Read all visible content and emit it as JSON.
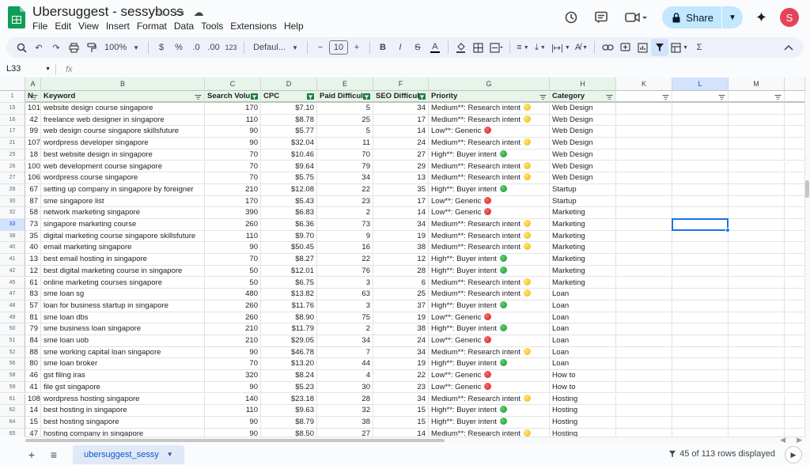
{
  "app": {
    "title": "Ubersuggest - sessyboss",
    "menus": [
      "File",
      "Edit",
      "View",
      "Insert",
      "Format",
      "Data",
      "Tools",
      "Extensions",
      "Help"
    ],
    "share_label": "Share",
    "avatar_letter": "S",
    "brand_color": "#0f9d58"
  },
  "toolbar": {
    "zoom": "100%",
    "currency": "$",
    "percent": "%",
    "dec_decrease": ".0",
    "dec_increase": ".00",
    "number_format": "123",
    "font": "Defaul...",
    "font_size": "10",
    "minus": "−",
    "plus": "+",
    "bold": "B",
    "italic": "I",
    "strike": "S",
    "text_color": "A"
  },
  "formula_bar": {
    "cell_ref": "L33",
    "fx": "fx"
  },
  "columns": {
    "letters": [
      "A",
      "B",
      "C",
      "D",
      "E",
      "F",
      "G",
      "H",
      "K",
      "L",
      "M"
    ],
    "headers": [
      "N",
      "Keyword",
      "Search Volu",
      "CPC",
      "Paid Difficul",
      "SEO Difficul",
      "Priority",
      "Category",
      "",
      "",
      ""
    ]
  },
  "rows": [
    {
      "row": "15",
      "n": "101",
      "keyword": "website design course singapore",
      "vol": "170",
      "cpc": "$7.10",
      "paid": "5",
      "seo": "34",
      "priority": "Medium**: Research intent",
      "dot": "yellow",
      "cat": "Web Design"
    },
    {
      "row": "16",
      "n": "42",
      "keyword": "freelance web designer in singapore",
      "vol": "110",
      "cpc": "$8.78",
      "paid": "25",
      "seo": "17",
      "priority": "Medium**: Research intent",
      "dot": "yellow",
      "cat": "Web Design"
    },
    {
      "row": "17",
      "n": "99",
      "keyword": "web design course singapore skillsfuture",
      "vol": "90",
      "cpc": "$5.77",
      "paid": "5",
      "seo": "14",
      "priority": "Low**: Generic",
      "dot": "red",
      "cat": "Web Design"
    },
    {
      "row": "21",
      "n": "107",
      "keyword": "wordpress developer singapore",
      "vol": "90",
      "cpc": "$32.04",
      "paid": "11",
      "seo": "24",
      "priority": "Medium**: Research intent",
      "dot": "yellow",
      "cat": "Web Design"
    },
    {
      "row": "25",
      "n": "18",
      "keyword": "best website design in singapore",
      "vol": "70",
      "cpc": "$10.46",
      "paid": "70",
      "seo": "27",
      "priority": "High**: Buyer intent",
      "dot": "green",
      "cat": "Web Design"
    },
    {
      "row": "26",
      "n": "100",
      "keyword": "web development course singapore",
      "vol": "70",
      "cpc": "$9.64",
      "paid": "79",
      "seo": "29",
      "priority": "Medium**: Research intent",
      "dot": "yellow",
      "cat": "Web Design"
    },
    {
      "row": "27",
      "n": "106",
      "keyword": "wordpress course singapore",
      "vol": "70",
      "cpc": "$5.75",
      "paid": "34",
      "seo": "13",
      "priority": "Medium**: Research intent",
      "dot": "yellow",
      "cat": "Web Design"
    },
    {
      "row": "28",
      "n": "67",
      "keyword": "setting up company in singapore by foreigner",
      "vol": "210",
      "cpc": "$12.08",
      "paid": "22",
      "seo": "35",
      "priority": "High**: Buyer intent",
      "dot": "green",
      "cat": "Startup"
    },
    {
      "row": "30",
      "n": "87",
      "keyword": "sme singapore list",
      "vol": "170",
      "cpc": "$5.43",
      "paid": "23",
      "seo": "17",
      "priority": "Low**: Generic",
      "dot": "red",
      "cat": "Startup"
    },
    {
      "row": "32",
      "n": "58",
      "keyword": "network marketing singapore",
      "vol": "390",
      "cpc": "$6.83",
      "paid": "2",
      "seo": "14",
      "priority": "Low**: Generic",
      "dot": "red",
      "cat": "Marketing"
    },
    {
      "row": "33",
      "n": "73",
      "keyword": "singapore marketing course",
      "vol": "260",
      "cpc": "$6.36",
      "paid": "73",
      "seo": "34",
      "priority": "Medium**: Research intent",
      "dot": "yellow",
      "cat": "Marketing"
    },
    {
      "row": "38",
      "n": "35",
      "keyword": "digital marketing course singapore skillsfuture",
      "vol": "110",
      "cpc": "$9.70",
      "paid": "9",
      "seo": "19",
      "priority": "Medium**: Research intent",
      "dot": "yellow",
      "cat": "Marketing"
    },
    {
      "row": "40",
      "n": "40",
      "keyword": "email marketing singapore",
      "vol": "90",
      "cpc": "$50.45",
      "paid": "16",
      "seo": "38",
      "priority": "Medium**: Research intent",
      "dot": "yellow",
      "cat": "Marketing"
    },
    {
      "row": "41",
      "n": "13",
      "keyword": "best email hosting in singapore",
      "vol": "70",
      "cpc": "$8.27",
      "paid": "22",
      "seo": "12",
      "priority": "High**: Buyer intent",
      "dot": "green",
      "cat": "Marketing"
    },
    {
      "row": "42",
      "n": "12",
      "keyword": "best digital marketing course in singapore",
      "vol": "50",
      "cpc": "$12.01",
      "paid": "76",
      "seo": "28",
      "priority": "High**: Buyer intent",
      "dot": "green",
      "cat": "Marketing"
    },
    {
      "row": "45",
      "n": "61",
      "keyword": "online marketing courses singapore",
      "vol": "50",
      "cpc": "$6.75",
      "paid": "3",
      "seo": "6",
      "priority": "Medium**: Research intent",
      "dot": "yellow",
      "cat": "Marketing"
    },
    {
      "row": "47",
      "n": "83",
      "keyword": "sme loan sg",
      "vol": "480",
      "cpc": "$13.82",
      "paid": "63",
      "seo": "25",
      "priority": "Medium**: Research intent",
      "dot": "yellow",
      "cat": "Loan"
    },
    {
      "row": "48",
      "n": "57",
      "keyword": "loan for business startup in singapore",
      "vol": "260",
      "cpc": "$11.76",
      "paid": "3",
      "seo": "37",
      "priority": "High**: Buyer intent",
      "dot": "green",
      "cat": "Loan"
    },
    {
      "row": "49",
      "n": "81",
      "keyword": "sme loan dbs",
      "vol": "260",
      "cpc": "$8.90",
      "paid": "75",
      "seo": "19",
      "priority": "Low**: Generic",
      "dot": "red",
      "cat": "Loan"
    },
    {
      "row": "50",
      "n": "79",
      "keyword": "sme business loan singapore",
      "vol": "210",
      "cpc": "$11.79",
      "paid": "2",
      "seo": "38",
      "priority": "High**: Buyer intent",
      "dot": "green",
      "cat": "Loan"
    },
    {
      "row": "51",
      "n": "84",
      "keyword": "sme loan uob",
      "vol": "210",
      "cpc": "$29.05",
      "paid": "34",
      "seo": "24",
      "priority": "Low**: Generic",
      "dot": "red",
      "cat": "Loan"
    },
    {
      "row": "52",
      "n": "88",
      "keyword": "sme working capital loan singapore",
      "vol": "90",
      "cpc": "$46.78",
      "paid": "7",
      "seo": "34",
      "priority": "Medium**: Research intent",
      "dot": "yellow",
      "cat": "Loan"
    },
    {
      "row": "56",
      "n": "80",
      "keyword": "sme loan broker",
      "vol": "70",
      "cpc": "$13.20",
      "paid": "44",
      "seo": "19",
      "priority": "High**: Buyer intent",
      "dot": "green",
      "cat": "Loan"
    },
    {
      "row": "58",
      "n": "46",
      "keyword": "gst filing iras",
      "vol": "320",
      "cpc": "$8.24",
      "paid": "4",
      "seo": "22",
      "priority": "Low**: Generic",
      "dot": "red",
      "cat": "How to"
    },
    {
      "row": "59",
      "n": "41",
      "keyword": "file gst singapore",
      "vol": "90",
      "cpc": "$5.23",
      "paid": "30",
      "seo": "23",
      "priority": "Low**: Generic",
      "dot": "red",
      "cat": "How to"
    },
    {
      "row": "61",
      "n": "108",
      "keyword": "wordpress hosting singapore",
      "vol": "140",
      "cpc": "$23.18",
      "paid": "28",
      "seo": "34",
      "priority": "Medium**: Research intent",
      "dot": "yellow",
      "cat": "Hosting"
    },
    {
      "row": "62",
      "n": "14",
      "keyword": "best hosting in singapore",
      "vol": "110",
      "cpc": "$9.63",
      "paid": "32",
      "seo": "15",
      "priority": "High**: Buyer intent",
      "dot": "green",
      "cat": "Hosting"
    },
    {
      "row": "64",
      "n": "15",
      "keyword": "best hosting singapore",
      "vol": "90",
      "cpc": "$8.79",
      "paid": "38",
      "seo": "15",
      "priority": "High**: Buyer intent",
      "dot": "green",
      "cat": "Hosting"
    },
    {
      "row": "65",
      "n": "47",
      "keyword": "hosting company in singapore",
      "vol": "90",
      "cpc": "$8.50",
      "paid": "27",
      "seo": "14",
      "priority": "Medium**: Research intent",
      "dot": "yellow",
      "cat": "Hosting"
    }
  ],
  "first_row_label": "1",
  "selected_row": "33",
  "selected_col": "L",
  "sheet": {
    "tab_name": "ubersuggest_sessy",
    "rows_displayed": "45 of 113 rows displayed"
  }
}
